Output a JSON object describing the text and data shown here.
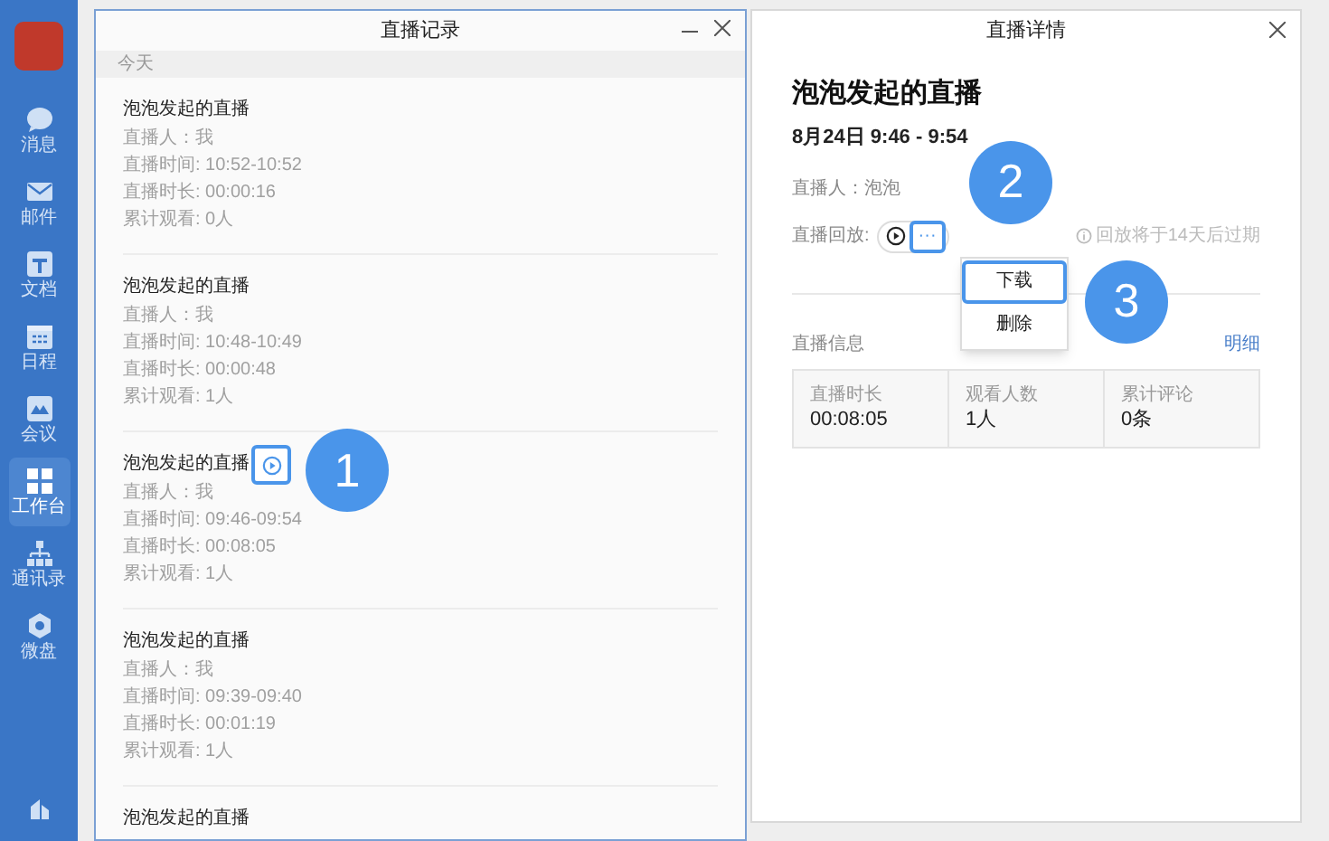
{
  "sidebar": {
    "items": [
      {
        "label": "消息",
        "kind": "chat",
        "selected": false
      },
      {
        "label": "邮件",
        "kind": "mail",
        "selected": false
      },
      {
        "label": "文档",
        "kind": "doc",
        "selected": false
      },
      {
        "label": "日程",
        "kind": "calendar",
        "selected": false
      },
      {
        "label": "会议",
        "kind": "meeting",
        "selected": false
      },
      {
        "label": "工作台",
        "kind": "grid",
        "selected": true
      },
      {
        "label": "通讯录",
        "kind": "org",
        "selected": false
      },
      {
        "label": "微盘",
        "kind": "drive",
        "selected": false
      }
    ]
  },
  "records_window": {
    "title": "直播记录",
    "section": "今天",
    "records": [
      {
        "title": "泡泡发起的直播",
        "details": [
          "直播人：我",
          "直播时间: 10:52-10:52",
          "直播时长: 00:00:16",
          "累计观看: 0人"
        ],
        "hovered": false
      },
      {
        "title": "泡泡发起的直播",
        "details": [
          "直播人：我",
          "直播时间: 10:48-10:49",
          "直播时长: 00:00:48",
          "累计观看: 1人"
        ],
        "hovered": false
      },
      {
        "title": "泡泡发起的直播",
        "details": [
          "直播人：我",
          "直播时间: 09:46-09:54",
          "直播时长: 00:08:05",
          "累计观看: 1人"
        ],
        "hovered": true,
        "badge": "1"
      },
      {
        "title": "泡泡发起的直播",
        "details": [
          "直播人：我",
          "直播时间: 09:39-09:40",
          "直播时长: 00:01:19",
          "累计观看: 1人"
        ],
        "hovered": false
      },
      {
        "title": "泡泡发起的直播",
        "hovered": false
      }
    ]
  },
  "detail_window": {
    "title": "直播详情",
    "heading": "泡泡发起的直播",
    "date": "8月24日 9:46 - 9:54",
    "host": "直播人：泡泡",
    "replay_label": "直播回放:",
    "more_badge": "2",
    "more": "···",
    "expiry_note": "回放将于14天后过期",
    "menu": {
      "badge": "3",
      "items": [
        {
          "label": "下载",
          "selected": true
        },
        {
          "label": "删除",
          "selected": false
        }
      ]
    },
    "info_label": "直播信息",
    "info_link": "明细",
    "stats": [
      {
        "label": "直播时长",
        "value": "00:08:05"
      },
      {
        "label": "观看人数",
        "value": "1人"
      },
      {
        "label": "累计评论",
        "value": "0条"
      }
    ]
  }
}
